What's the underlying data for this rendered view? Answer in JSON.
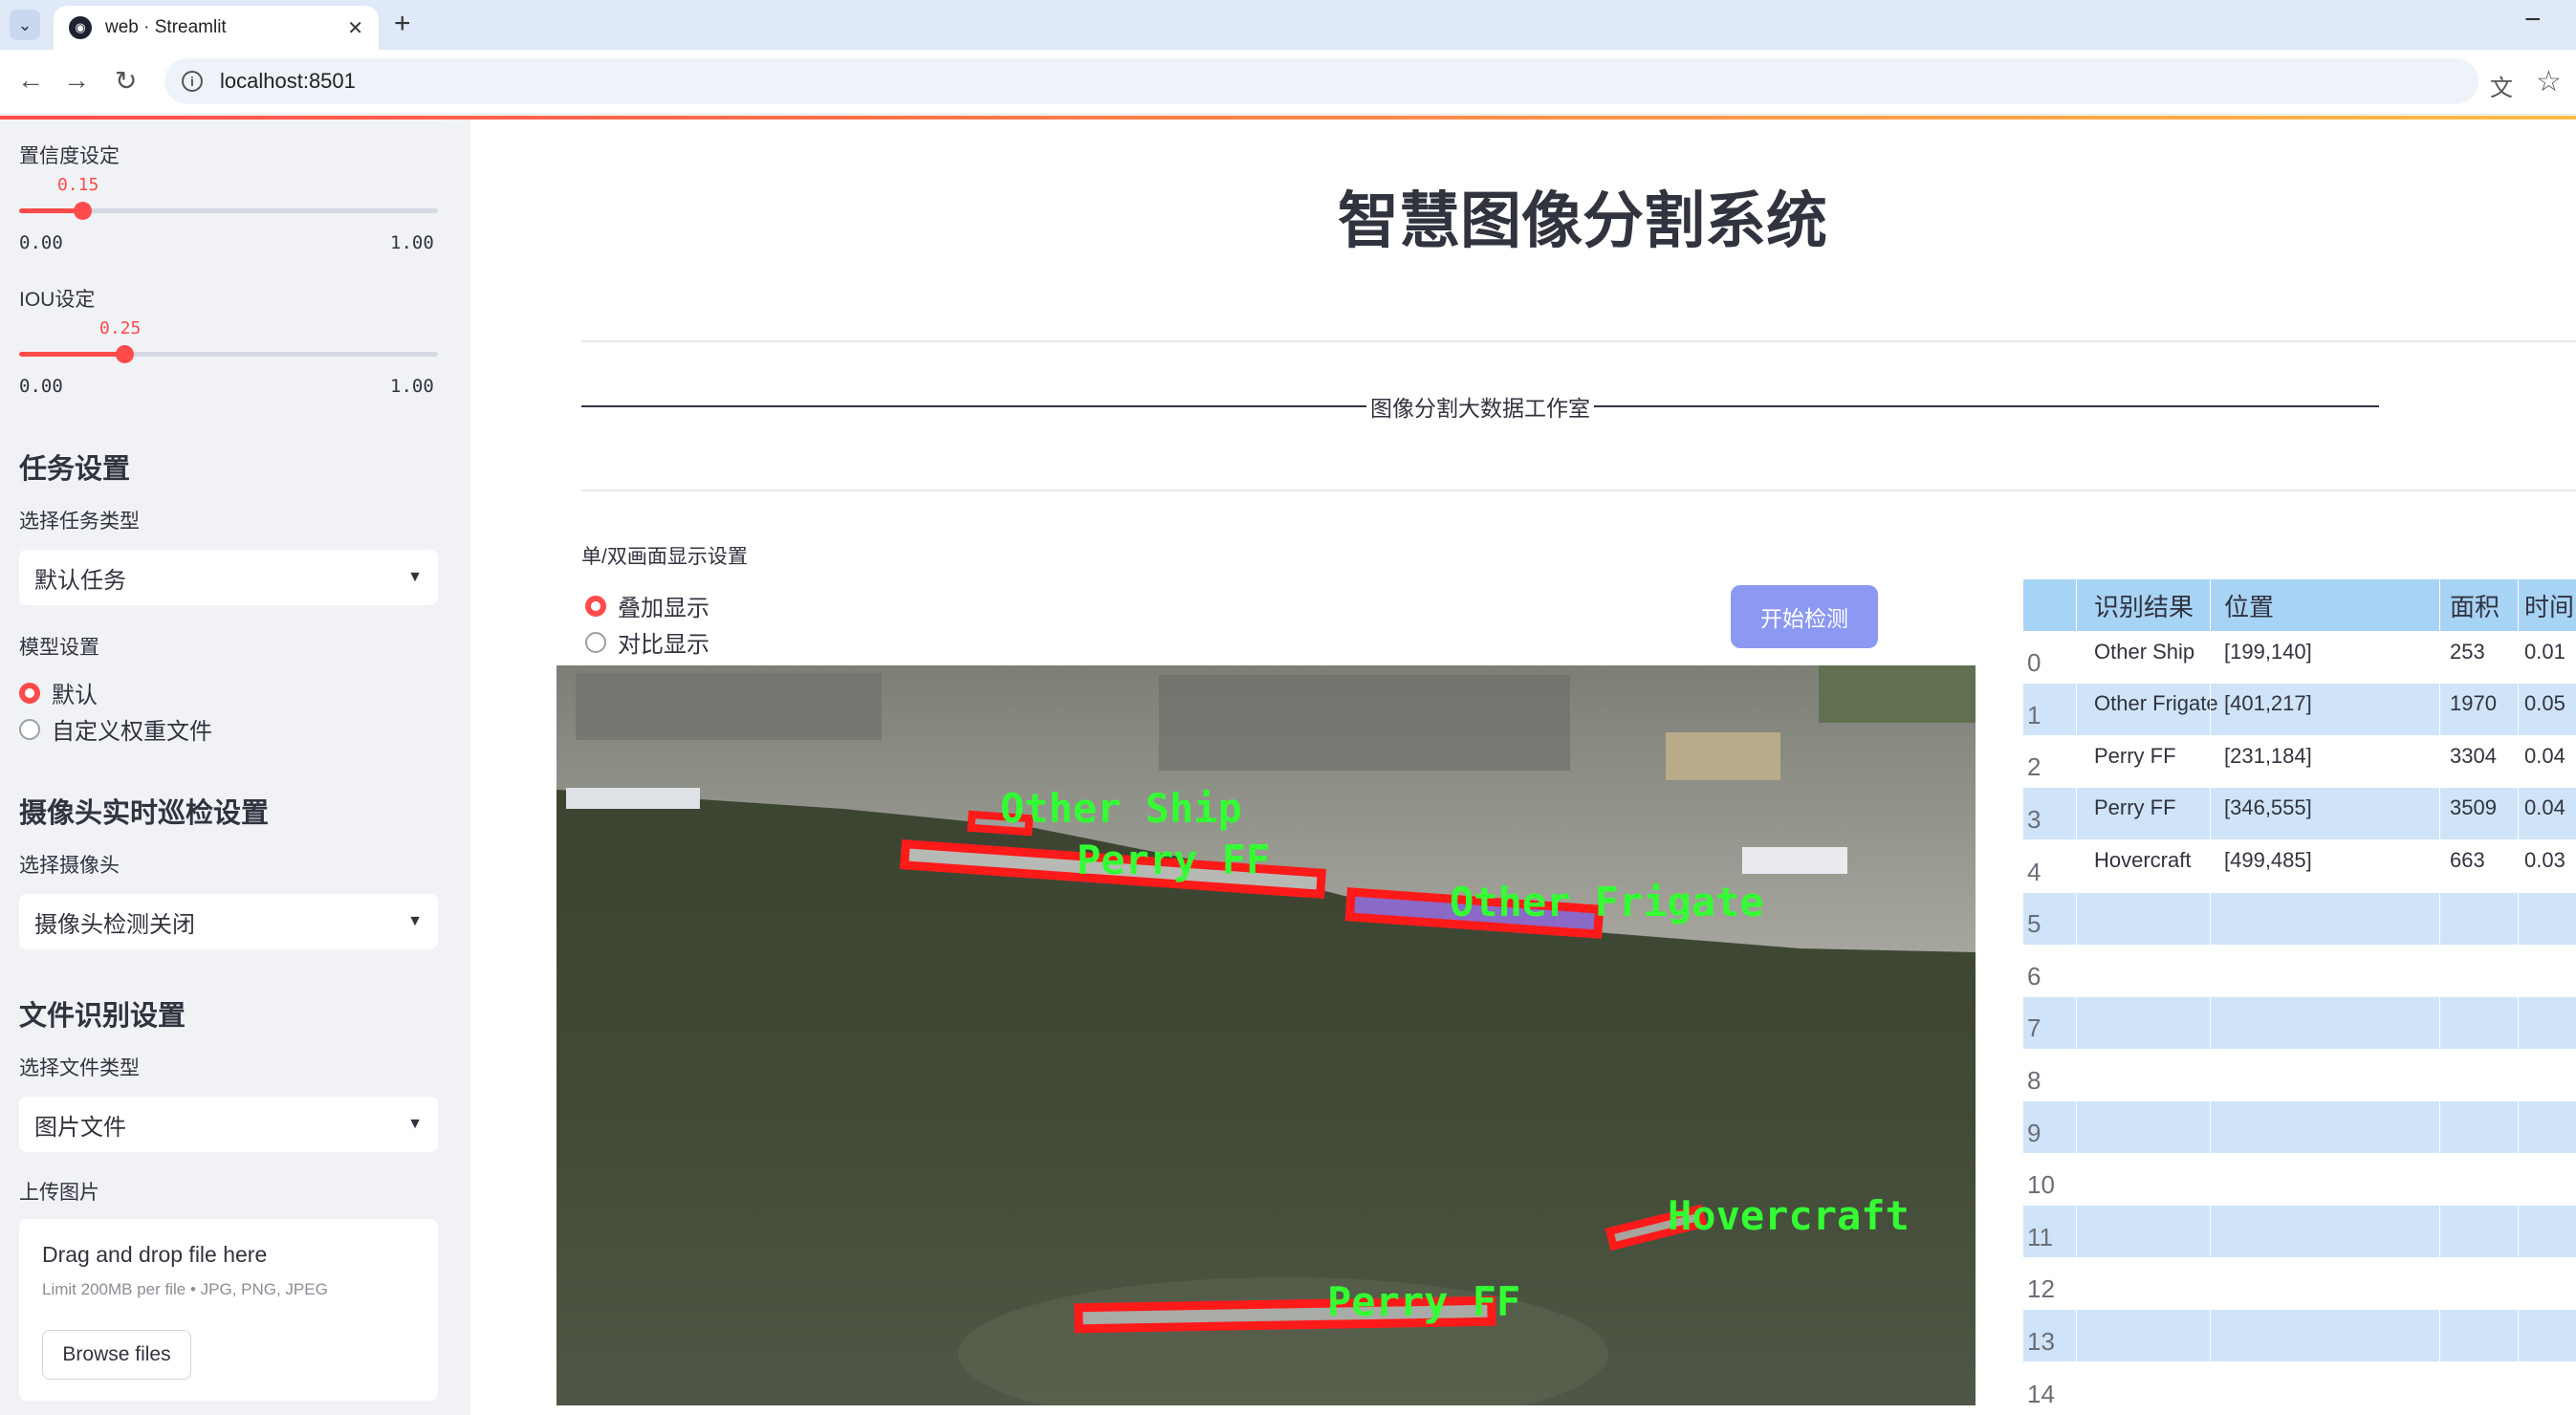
{
  "browser": {
    "tab_title": "web · Streamlit",
    "url": "localhost:8501"
  },
  "sidebar": {
    "confidence": {
      "label": "置信度设定",
      "value": "0.15",
      "min": "0.00",
      "max": "1.00",
      "fraction": 0.15
    },
    "iou": {
      "label": "IOU设定",
      "value": "0.25",
      "min": "0.00",
      "max": "1.00",
      "fraction": 0.25
    },
    "task_heading": "任务设置",
    "task_type_label": "选择任务类型",
    "task_type_value": "默认任务",
    "model_label": "模型设置",
    "model_options": [
      "默认",
      "自定义权重文件"
    ],
    "model_selected": 0,
    "camera_heading": "摄像头实时巡检设置",
    "camera_label": "选择摄像头",
    "camera_value": "摄像头检测关闭",
    "file_heading": "文件识别设置",
    "file_type_label": "选择文件类型",
    "file_type_value": "图片文件",
    "upload_label": "上传图片",
    "upload_title": "Drag and drop file here",
    "upload_limit": "Limit 200MB per file • JPG, PNG, JPEG",
    "browse_label": "Browse files"
  },
  "main": {
    "title": "智慧图像分割系统",
    "studio": "图像分割大数据工作室",
    "display_mode_label": "单/双画面显示设置",
    "display_options": [
      "叠加显示",
      "对比显示"
    ],
    "display_selected": 0,
    "start_button": "开始检测"
  },
  "detections": [
    {
      "label": "Other Ship"
    },
    {
      "label": "Perry FF"
    },
    {
      "label": "Other Frigate"
    },
    {
      "label": "Hovercraft"
    },
    {
      "label": "Perry FF"
    }
  ],
  "table": {
    "headers": [
      "",
      "识别结果",
      "位置",
      "面积",
      "时间"
    ],
    "rows": [
      [
        "0",
        "Other Ship",
        "[199,140]",
        "253",
        "0.01"
      ],
      [
        "1",
        "Other Frigate",
        "[401,217]",
        "1970",
        "0.05"
      ],
      [
        "2",
        "Perry FF",
        "[231,184]",
        "3304",
        "0.04"
      ],
      [
        "3",
        "Perry FF",
        "[346,555]",
        "3509",
        "0.04"
      ],
      [
        "4",
        "Hovercraft",
        "[499,485]",
        "663",
        "0.03"
      ],
      [
        "5",
        "",
        "",
        "",
        ""
      ],
      [
        "6",
        "",
        "",
        "",
        ""
      ],
      [
        "7",
        "",
        "",
        "",
        ""
      ],
      [
        "8",
        "",
        "",
        "",
        ""
      ],
      [
        "9",
        "",
        "",
        "",
        ""
      ],
      [
        "10",
        "",
        "",
        "",
        ""
      ],
      [
        "11",
        "",
        "",
        "",
        ""
      ],
      [
        "12",
        "",
        "",
        "",
        ""
      ],
      [
        "13",
        "",
        "",
        "",
        ""
      ],
      [
        "14",
        "",
        "",
        "",
        ""
      ]
    ]
  }
}
